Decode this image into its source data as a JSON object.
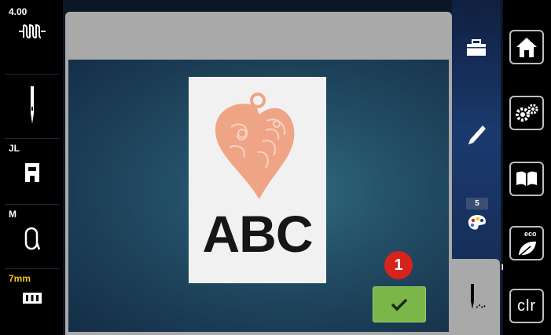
{
  "left_status": {
    "stitch_width": "4.00",
    "presser_foot": "JL",
    "hoop": "M",
    "bobbin": "7mm"
  },
  "design": {
    "text": "ABC"
  },
  "callout": {
    "number": "1"
  },
  "right_panel": {
    "layer_count": "5",
    "clear_label": "clr",
    "eco_label": "eco"
  },
  "colors": {
    "confirm_green": "#7ab648",
    "callout_red": "#d8231d",
    "heart_salmon": "#f0a486",
    "accent_yellow": "#f0c419"
  }
}
